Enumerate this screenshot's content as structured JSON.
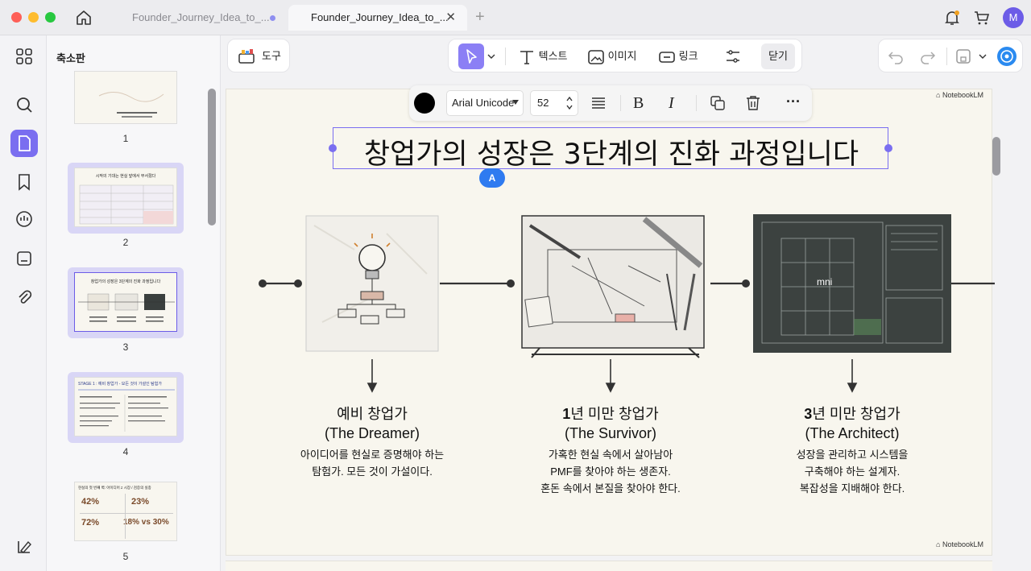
{
  "window": {
    "tabs": [
      {
        "label": "Founder_Journey_Idea_to_..."
      },
      {
        "label": "Founder_Journey_Idea_to_..."
      }
    ]
  },
  "user": {
    "avatar_initial": "M"
  },
  "sidebar": {
    "panel_title": "축소판",
    "pages": [
      "1",
      "2",
      "3",
      "4",
      "5"
    ],
    "thumb2": {
      "title": "시작의 기대는 현실 앞에서 무서졌다"
    },
    "thumb3": {
      "title": "창업가의 성장은 3단계의 진화 과정입니다"
    },
    "thumb4": {
      "title": "STAGE 1 : 예비 창업가 - 모든 것이 가설인 탐험가"
    },
    "thumb5": {
      "title": "현실의 첫 번째 벽: 아이디어 ≠ 시장 / 검증의 실종",
      "stats": [
        "42%",
        "23%",
        "72%",
        "18% vs 30%"
      ]
    }
  },
  "toolbar": {
    "tool_label": "도구",
    "text_label": "텍스트",
    "image_label": "이미지",
    "link_label": "링크",
    "close_label": "닫기"
  },
  "format_bar": {
    "font": "Arial Unicode",
    "size": "52"
  },
  "slide": {
    "watermark": "NotebookLM",
    "title": "창업가의 성장은 3단계의 진화 과정입니다",
    "annotation_badge": "A",
    "stages": [
      {
        "title_bold": "",
        "title": "예비 창업가",
        "subtitle": "(The Dreamer)",
        "desc_lines": [
          "아이디어를 현실로 증명해야 하는",
          "탐험가. 모든 것이 가설이다."
        ]
      },
      {
        "title_bold": "1",
        "title": "년 미만 창업가",
        "subtitle": "(The Survivor)",
        "desc_lines": [
          "가혹한 현실 속에서 살아남아",
          "PMF를 찾아야 하는 생존자.",
          "혼돈 속에서 본질을 찾아야 한다."
        ]
      },
      {
        "title_bold": "3",
        "title": "년 미만 창업가",
        "subtitle": "(The Architect)",
        "desc_lines": [
          "성장을 관리하고 시스템을",
          "구축해야 하는 설계자.",
          "복잡성을 지배해야 한다."
        ]
      }
    ],
    "blueprint_label": "mni"
  },
  "colors": {
    "accent": "#7a6ef0",
    "badge": "#2f7bf0",
    "slide_bg": "#f8f6ee"
  }
}
